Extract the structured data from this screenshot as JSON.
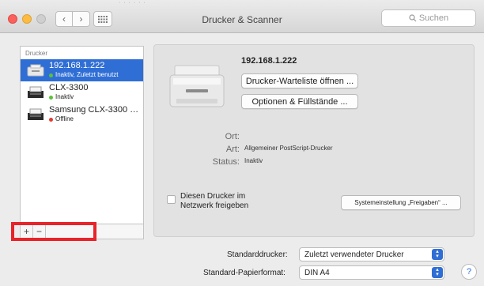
{
  "window": {
    "title": "Drucker & Scanner",
    "search_placeholder": "Suchen",
    "top_strip": "·  ·  ·  ·  ·  ·"
  },
  "sidebar": {
    "header": "Drucker",
    "printers": [
      {
        "name": "192.168.1.222",
        "status": "Inaktiv, Zuletzt benutzt",
        "status_color": "#5bc236",
        "selected": true
      },
      {
        "name": "CLX-3300",
        "status": "Inaktiv",
        "status_color": "#5bc236",
        "selected": false
      },
      {
        "name": "Samsung CLX-3300 S...",
        "status": "Offline",
        "status_color": "#e23a30",
        "selected": false
      }
    ],
    "add_label": "+",
    "remove_label": "−"
  },
  "detail": {
    "printer_name": "192.168.1.222",
    "queue_button": "Drucker-Warteliste öffnen ...",
    "options_button": "Optionen & Füllstände ...",
    "location_label": "Ort:",
    "location_value": "",
    "kind_label": "Art:",
    "kind_value": "Allgemeiner PostScript-Drucker",
    "status_label": "Status:",
    "status_value": "Inaktiv",
    "share_label_line1": "Diesen Drucker im",
    "share_label_line2": "Netzwerk freigeben",
    "sharing_prefs_button": "Systemeinstellung „Freigaben“ ..."
  },
  "bottom": {
    "default_printer_label": "Standarddrucker:",
    "default_printer_value": "Zuletzt verwendeter Drucker",
    "paper_size_label": "Standard-Papierformat:",
    "paper_size_value": "DIN A4",
    "help_label": "?"
  },
  "colors": {
    "accent": "#2f6ed5",
    "highlight": "#e8232a"
  }
}
